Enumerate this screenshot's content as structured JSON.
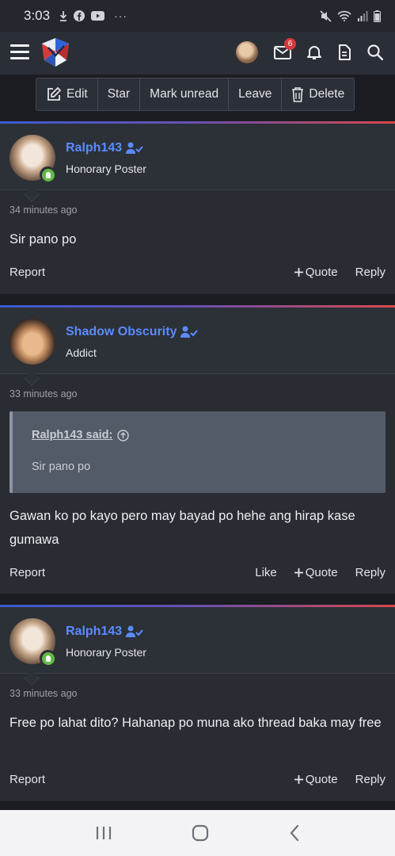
{
  "status_bar": {
    "time": "3:03",
    "left_icons": [
      "download-icon",
      "facebook-icon",
      "youtube-icon",
      "more-icon"
    ],
    "right_icons": [
      "mute-icon",
      "wifi-icon",
      "signal-icon",
      "battery-icon"
    ]
  },
  "header": {
    "icons": [
      "menu-icon",
      "site-logo",
      "user-avatar",
      "mail-icon",
      "bell-icon",
      "document-icon",
      "search-icon"
    ],
    "mail_badge": "6"
  },
  "toolbar": {
    "edit": "Edit",
    "star": "Star",
    "mark_unread": "Mark unread",
    "leave": "Leave",
    "delete": "Delete"
  },
  "posts": [
    {
      "username": "Ralph143",
      "title": "Honorary Poster",
      "time": "34 minutes ago",
      "body": "Sir pano po",
      "actions": {
        "report": "Report",
        "quote": "Quote",
        "reply": "Reply"
      }
    },
    {
      "username": "Shadow Obscurity",
      "title": "Addict",
      "time": "33 minutes ago",
      "quote": {
        "author": "Ralph143 said:",
        "text": "Sir pano po"
      },
      "body": "Gawan ko po kayo pero may bayad po hehe ang hirap kase gumawa",
      "actions": {
        "report": "Report",
        "like": "Like",
        "quote": "Quote",
        "reply": "Reply"
      }
    },
    {
      "username": "Ralph143",
      "title": "Honorary Poster",
      "time": "33 minutes ago",
      "body": "Free po lahat dito? Hahanap po muna ako thread baka may free",
      "actions": {
        "report": "Report",
        "quote": "Quote",
        "reply": "Reply"
      }
    }
  ],
  "colors": {
    "username": "#5a8cff",
    "online": "#63b946",
    "badge": "#d23a3a",
    "background": "#1b1d22"
  }
}
